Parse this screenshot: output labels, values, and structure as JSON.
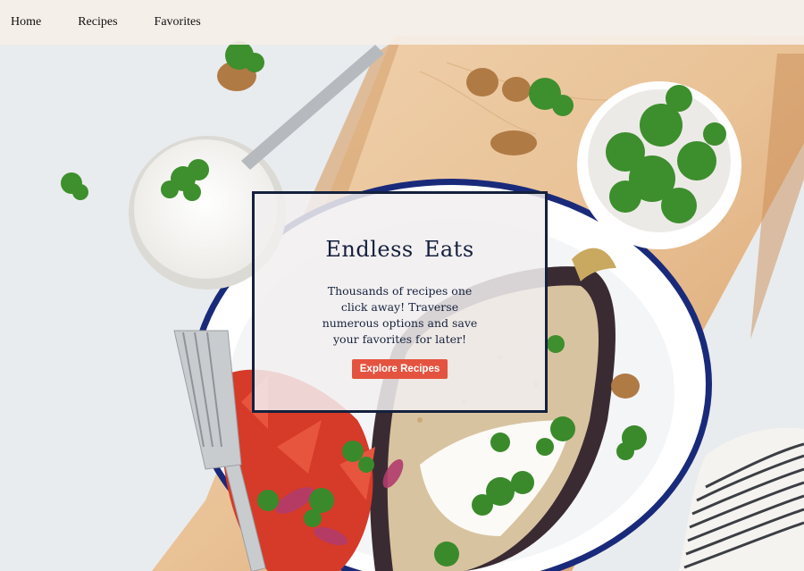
{
  "nav": {
    "items": [
      {
        "label": "Home"
      },
      {
        "label": "Recipes"
      },
      {
        "label": "Favorites"
      }
    ]
  },
  "hero": {
    "title": "Endless Eats",
    "description": "Thousands of recipes one click away! Traverse numerous options and save your favorites for later!",
    "cta_label": "Explore Recipes"
  },
  "colors": {
    "accent": "#e4533f",
    "navy": "#14213d",
    "navbar_bg": "#f5efe8"
  },
  "icons": [
    "food-photo-background"
  ]
}
